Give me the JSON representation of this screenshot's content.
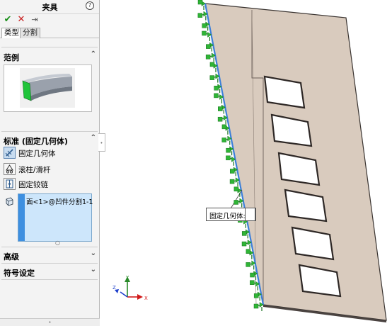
{
  "pm": {
    "title": "夹具",
    "help": "?",
    "ok": "✔",
    "cancel": "✕",
    "pin": "⇥"
  },
  "tabs": [
    {
      "label": "类型"
    },
    {
      "label": "分割"
    }
  ],
  "sections": {
    "example": {
      "label": "范例",
      "chevron": "⌃"
    },
    "standard": {
      "label": "标准 (固定几何体)",
      "chevron": "⌃"
    },
    "advanced": {
      "label": "高级",
      "chevron": "⌄"
    },
    "symbol": {
      "label": "符号设定",
      "chevron": "⌄"
    }
  },
  "options": [
    {
      "label": "固定几何体",
      "selected": true
    },
    {
      "label": "滚柱/滑杆",
      "selected": false
    },
    {
      "label": "固定铰链",
      "selected": false
    }
  ],
  "selection": {
    "item": "面<1>@凹件分割1-1"
  },
  "callout": {
    "label": "固定几何体:"
  },
  "triad": {
    "x": "X",
    "y": "Y",
    "z": "Z"
  },
  "colors": {
    "plate": "#d9cbbe",
    "plate_edge": "#3a3431",
    "selected_edge": "#3b7fd9",
    "fixture": "#2fb536",
    "example_face": "#1fc43a"
  },
  "icons": {
    "help": "help-icon",
    "ok": "check-icon",
    "cancel": "close-icon",
    "pin": "pushpin-icon",
    "fixed": "fixed-geometry-icon",
    "roller": "roller-slider-icon",
    "hinge": "fixed-hinge-icon",
    "selection": "face-selection-icon"
  }
}
